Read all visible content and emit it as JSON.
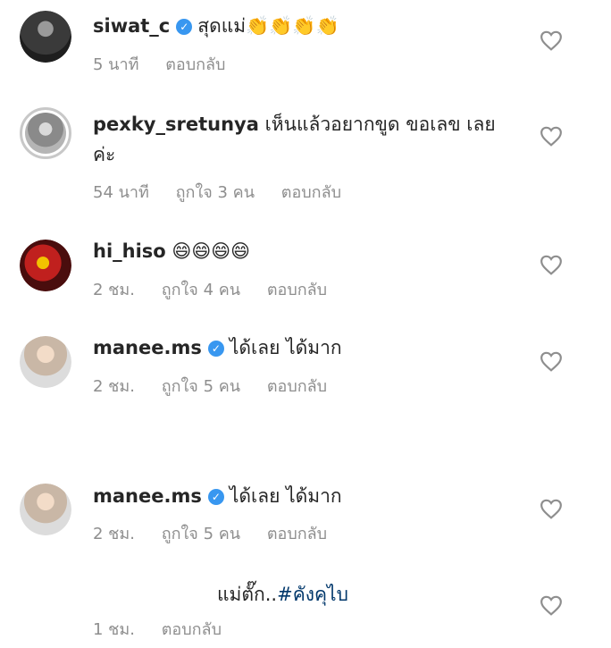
{
  "comments": [
    {
      "username": "siwat_c",
      "verified": true,
      "text": "สุดแม่👏👏👏👏",
      "time": "5 นาที",
      "likes": "",
      "reply": "ตอบกลับ"
    },
    {
      "username": "pexky_sretunya",
      "verified": false,
      "text": "เห็นแล้วอยากขูด ขอเลข เลย",
      "text2": "ค่ะ",
      "time": "54 นาที",
      "likes": "ถูกใจ 3 คน",
      "reply": "ตอบกลับ"
    },
    {
      "username": "hi_hiso",
      "verified": false,
      "text": "😄😄😄😄",
      "time": "2 ชม.",
      "likes": "ถูกใจ 4 คน",
      "reply": "ตอบกลับ"
    },
    {
      "username": "manee.ms",
      "verified": true,
      "text": "ได้เลย ได้มาก",
      "time": "2 ชม.",
      "likes": "ถูกใจ 5 คน",
      "reply": "ตอบกลับ"
    },
    {
      "username": "manee.ms",
      "verified": true,
      "text": "ได้เลย ได้มาก",
      "time": "2 ชม.",
      "likes": "ถูกใจ 5 คน",
      "reply": "ตอบกลับ"
    }
  ],
  "last": {
    "text_plain": "แม่ตั๊ก..",
    "hashtag": "#คังคุไบ",
    "time": "1 ชม.",
    "reply": "ตอบกลับ"
  },
  "verified_glyph": "✓",
  "colors": {
    "verified": "#3897f0",
    "meta": "#8e8e8e",
    "hashtag": "#00376b"
  }
}
